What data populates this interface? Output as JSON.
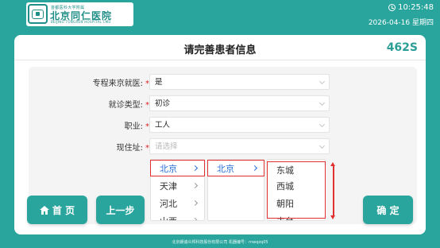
{
  "header": {
    "logo_small": "首都医科大学附属",
    "logo_main": "北京同仁医院",
    "logo_en": "BEIJING TONGREN HOSPITAL CMU",
    "time": "10:25:48",
    "date": "2026-04-16 星期四"
  },
  "panel": {
    "title": "请完善患者信息",
    "countdown": "462S"
  },
  "form": {
    "rows": [
      {
        "label": "专程来京就医:",
        "required": "*",
        "value": "是",
        "is_placeholder": false
      },
      {
        "label": "就诊类型:",
        "required": "*",
        "value": "初诊",
        "is_placeholder": false
      },
      {
        "label": "职业:",
        "required": "*",
        "value": "工人",
        "is_placeholder": false
      },
      {
        "label": "现住址:",
        "required": "*",
        "value": "请选择",
        "is_placeholder": true
      }
    ]
  },
  "cascader": {
    "provinces": [
      "北京",
      "天津",
      "河北",
      "山西"
    ],
    "cities": [
      "北京"
    ],
    "districts": [
      "东城",
      "西城",
      "朝阳",
      "丰台"
    ],
    "selected_province": "北京",
    "selected_city": "北京"
  },
  "buttons": {
    "home": "首 页",
    "prev": "上一步",
    "confirm": "确 定"
  },
  "footer": {
    "text": "北京朗诚众邦科技股份有限公司  机器编号：rnwqzq05"
  },
  "colors": {
    "brand": "#2aa59e",
    "accent_blue": "#2a6fd8",
    "required_red": "#e02020",
    "highlight_red": "#e03030"
  },
  "icons": {
    "clock": "clock-icon",
    "home": "home-icon"
  }
}
